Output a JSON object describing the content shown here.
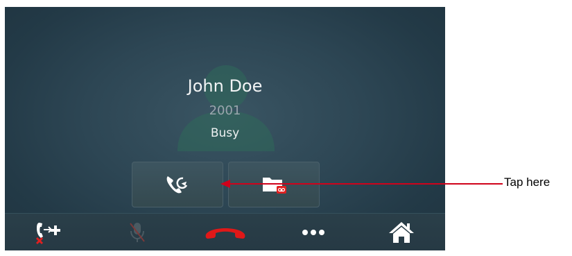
{
  "contact": {
    "name": "John Doe",
    "number": "2001",
    "status": "Busy"
  },
  "actions": [
    {
      "icon": "call-forward-icon",
      "state": "highlighted"
    },
    {
      "icon": "voicemail-folder-icon"
    }
  ],
  "nav": [
    {
      "icon": "transfer-unavailable-icon"
    },
    {
      "icon": "mute-disabled-icon"
    },
    {
      "icon": "hang-up-icon",
      "color": "#e01818"
    },
    {
      "icon": "more-icon"
    },
    {
      "icon": "home-icon"
    }
  ],
  "annotation": {
    "label": "Tap here",
    "arrow_color": "#d0021b"
  },
  "colors": {
    "screen_bg": "#2d4654",
    "hangup_red": "#e01818",
    "badge_red": "#e02020"
  }
}
